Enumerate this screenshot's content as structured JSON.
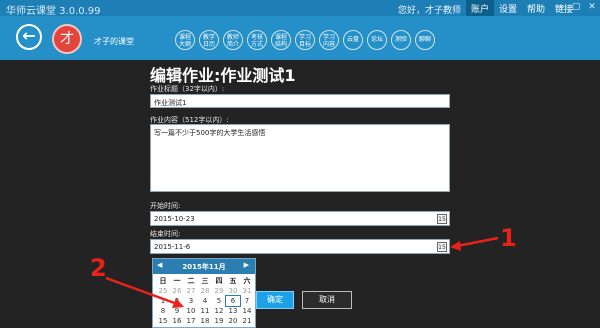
{
  "window": {
    "title": "华师云课堂 3.0.0.99",
    "greeting": "您好，才子教师",
    "top_nav": [
      "账户",
      "设置",
      "帮助",
      "链接"
    ],
    "controls": [
      "—",
      "▢",
      "✕"
    ]
  },
  "course": {
    "title": "才子的课堂",
    "avatar_text": "才",
    "nav_buttons": [
      {
        "label": "课程\n大纲"
      },
      {
        "label": "教学\n日历"
      },
      {
        "label": "教师\n简介"
      },
      {
        "label": "考核\n方式"
      },
      {
        "label": "课程\n结构"
      },
      {
        "label": "学习\n目标"
      },
      {
        "label": "学习\n内容"
      },
      {
        "label": "云盘"
      },
      {
        "label": "论坛"
      },
      {
        "label": "测验"
      },
      {
        "label": "聊聊"
      }
    ]
  },
  "form": {
    "page_title": "编辑作业:作业测试1",
    "title_label": "作业标题（32字以内）:",
    "title_value": "作业测试1",
    "content_label": "作业内容（512字以内）:",
    "content_value": "写一篇不少于500字的大学生活感悟",
    "start_label": "开始时间:",
    "start_value": "2015-10-23",
    "end_label": "结束时间:",
    "end_value": "2015-11-6",
    "ok_label": "确定",
    "cancel_label": "取消"
  },
  "calendar": {
    "title": "2015年11月",
    "prev": "◀",
    "next": "▶",
    "weekdays": [
      "日",
      "一",
      "二",
      "三",
      "四",
      "五",
      "六"
    ],
    "days": [
      {
        "d": "25",
        "other": true
      },
      {
        "d": "26",
        "other": true
      },
      {
        "d": "27",
        "other": true
      },
      {
        "d": "28",
        "other": true
      },
      {
        "d": "29",
        "other": true
      },
      {
        "d": "30",
        "other": true
      },
      {
        "d": "31",
        "other": true
      },
      {
        "d": "1"
      },
      {
        "d": "2"
      },
      {
        "d": "3"
      },
      {
        "d": "4"
      },
      {
        "d": "5"
      },
      {
        "d": "6",
        "today": true
      },
      {
        "d": "7"
      },
      {
        "d": "8"
      },
      {
        "d": "9"
      },
      {
        "d": "10"
      },
      {
        "d": "11"
      },
      {
        "d": "12"
      },
      {
        "d": "13"
      },
      {
        "d": "14"
      },
      {
        "d": "15"
      },
      {
        "d": "16"
      },
      {
        "d": "17"
      },
      {
        "d": "18"
      },
      {
        "d": "19"
      },
      {
        "d": "20"
      },
      {
        "d": "21"
      }
    ]
  },
  "annotations": {
    "marker1": "1",
    "marker2": "2",
    "color": "#e8221a"
  }
}
